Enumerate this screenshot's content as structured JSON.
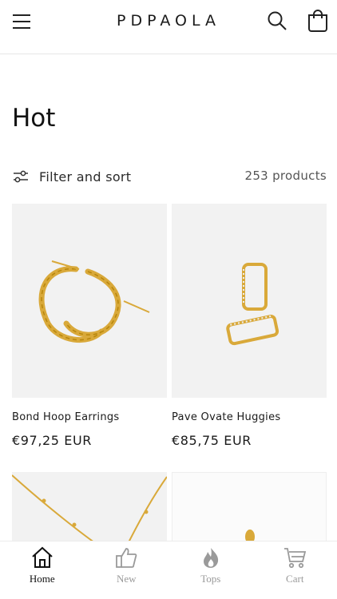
{
  "header": {
    "brand": "PDPAOLA",
    "menu_icon": "hamburger-menu-icon",
    "search_icon": "search-icon",
    "cart_icon": "shopping-bag-icon"
  },
  "page": {
    "title": "Hot"
  },
  "filter": {
    "label": "Filter and sort",
    "icon": "sliders-icon",
    "product_count": "253 products"
  },
  "products": [
    {
      "name": "Bond Hoop Earrings",
      "price": "€97,25 EUR"
    },
    {
      "name": "Pave Ovate Huggies",
      "price": "€85,75 EUR"
    },
    {
      "name": "",
      "price": ""
    },
    {
      "name": "",
      "price": ""
    }
  ],
  "tabbar": {
    "items": [
      {
        "label": "Home",
        "icon": "home-icon",
        "active": true
      },
      {
        "label": "New",
        "icon": "thumbs-up-icon",
        "active": false
      },
      {
        "label": "Tops",
        "icon": "flame-icon",
        "active": false
      },
      {
        "label": "Cart",
        "icon": "cart-icon",
        "active": false
      }
    ]
  },
  "colors": {
    "text": "#121212",
    "muted": "#9a9a9a",
    "gold": "#d9a93a",
    "image_bg": "#f2f2f2"
  }
}
